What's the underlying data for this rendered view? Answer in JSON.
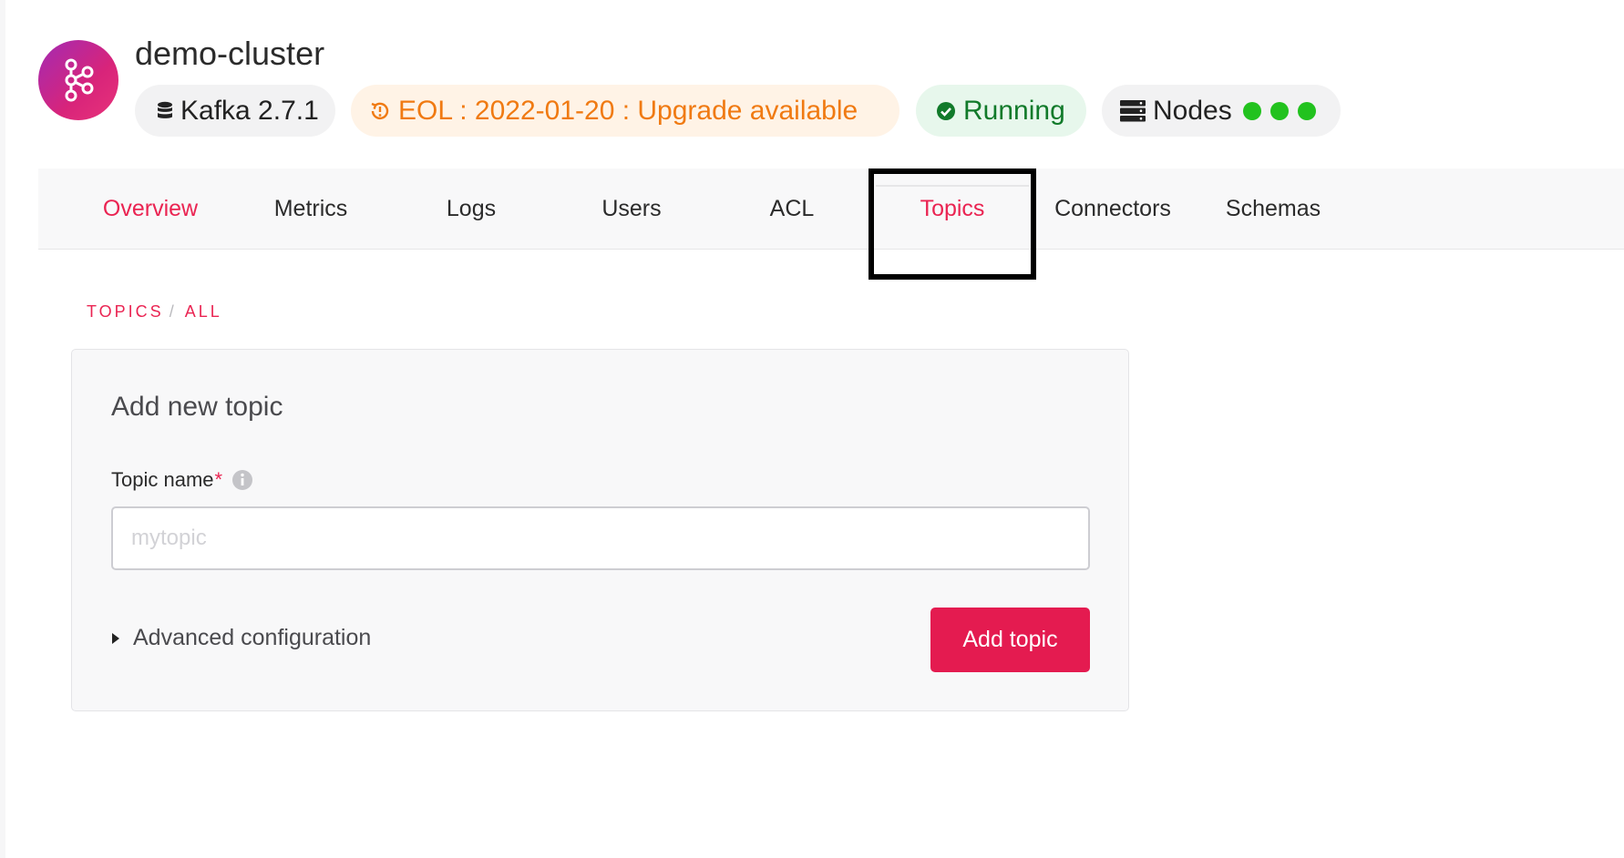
{
  "header": {
    "cluster_name": "demo-cluster",
    "logo_icon": "kafka-logo-icon",
    "version_label": "Kafka 2.7.1",
    "eol_label": "EOL : 2022-01-20 : Upgrade available",
    "status_label": "Running",
    "nodes_label": "Nodes",
    "nodes_count": 3,
    "colors": {
      "eol": "#f07a12",
      "running": "#117a2a",
      "node_dot": "#22c21e"
    }
  },
  "tabs": [
    {
      "label": "Overview"
    },
    {
      "label": "Metrics"
    },
    {
      "label": "Logs"
    },
    {
      "label": "Users"
    },
    {
      "label": "ACL"
    },
    {
      "label": "Topics"
    },
    {
      "label": "Connectors"
    },
    {
      "label": "Schemas"
    }
  ],
  "active_tab": "Topics",
  "breadcrumb": {
    "root": "TOPICS",
    "separator": "/",
    "current": "ALL"
  },
  "form": {
    "title": "Add new topic",
    "topic_name_label": "Topic name",
    "required_mark": "*",
    "topic_name_placeholder": "mytopic",
    "topic_name_value": "",
    "advanced_label": "Advanced configuration",
    "submit_label": "Add topic"
  },
  "theme": {
    "accent": "#ea2452",
    "button": "#e41b50"
  }
}
